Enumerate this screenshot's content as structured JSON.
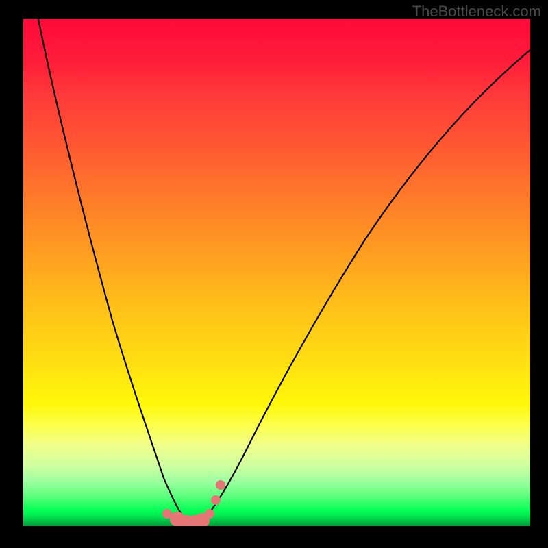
{
  "watermark": "TheBottleneck.com",
  "chart_data": {
    "type": "line",
    "title": "",
    "xlabel": "",
    "ylabel": "",
    "xlim": [
      0,
      100
    ],
    "ylim": [
      0,
      100
    ],
    "series": [
      {
        "name": "bottleneck-curve",
        "x": [
          3,
          5,
          8,
          12,
          16,
          20,
          23,
          26,
          28,
          30,
          31,
          32,
          33,
          34,
          35,
          36,
          38,
          40,
          43,
          47,
          52,
          58,
          65,
          73,
          82,
          90,
          95,
          100
        ],
        "y": [
          100,
          92,
          80,
          65,
          50,
          36,
          25,
          15,
          8,
          3,
          1,
          0.5,
          0.5,
          0.8,
          1.5,
          3,
          7,
          13,
          22,
          33,
          45,
          57,
          67,
          76,
          84,
          89,
          92,
          95
        ]
      }
    ],
    "reference_points": {
      "name": "marked-configurations",
      "x": [
        28.5,
        30.5,
        32,
        33.5,
        35,
        36,
        37.5,
        38.5
      ],
      "y": [
        2.5,
        1.2,
        0.8,
        0.8,
        1.0,
        2.5,
        5.5,
        8.5
      ]
    },
    "gradient_stops": [
      {
        "pos": 0,
        "color": "#ff0a3a"
      },
      {
        "pos": 25,
        "color": "#ff5832"
      },
      {
        "pos": 55,
        "color": "#ffbb1a"
      },
      {
        "pos": 76,
        "color": "#fff80a"
      },
      {
        "pos": 94,
        "color": "#60ff80"
      },
      {
        "pos": 100,
        "color": "#009a38"
      }
    ]
  }
}
